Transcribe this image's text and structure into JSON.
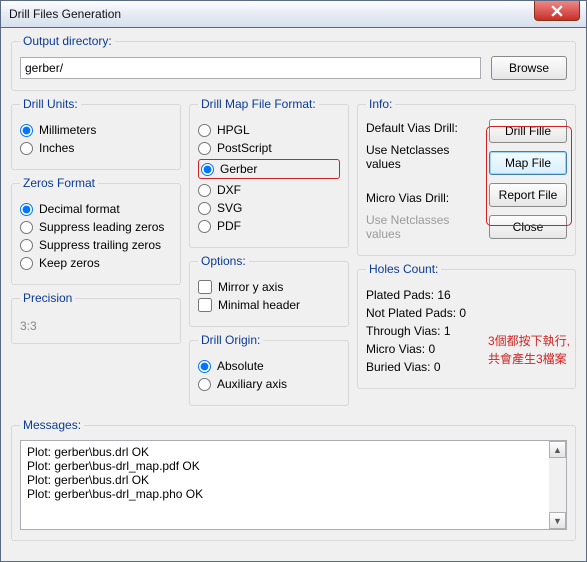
{
  "title": "Drill Files Generation",
  "output": {
    "legend": "Output directory:",
    "value": "gerber/",
    "browse": "Browse"
  },
  "drillUnits": {
    "legend": "Drill Units:",
    "options": {
      "mm": "Millimeters",
      "in": "Inches"
    },
    "selected": "mm"
  },
  "zeros": {
    "legend": "Zeros Format",
    "options": {
      "dec": "Decimal format",
      "sl": "Suppress leading zeros",
      "st": "Suppress trailing zeros",
      "kz": "Keep zeros"
    },
    "selected": "dec"
  },
  "precision": {
    "legend": "Precision",
    "value": "3:3"
  },
  "mapfmt": {
    "legend": "Drill Map File Format:",
    "options": {
      "hpgl": "HPGL",
      "ps": "PostScript",
      "gerber": "Gerber",
      "dxf": "DXF",
      "svg": "SVG",
      "pdf": "PDF"
    },
    "selected": "gerber"
  },
  "options": {
    "legend": "Options:",
    "mirror": "Mirror y axis",
    "minimal": "Minimal header"
  },
  "origin": {
    "legend": "Drill Origin:",
    "options": {
      "abs": "Absolute",
      "aux": "Auxiliary axis"
    },
    "selected": "abs"
  },
  "info": {
    "legend": "Info:",
    "defVias": "Default Vias Drill:",
    "useNet1": "Use Netclasses values",
    "microVias": "Micro Vias Drill:",
    "useNet2": "Use Netclasses values",
    "buttons": {
      "drill": "Drill Fille",
      "map": "Map File",
      "report": "Report File",
      "close": "Close"
    }
  },
  "holes": {
    "legend": "Holes Count:",
    "plated": "Plated Pads: 16",
    "notPlated": "Not Plated Pads: 0",
    "through": "Through Vias: 1",
    "micro": "Micro Vias: 0",
    "buried": "Buried Vias: 0"
  },
  "annotation": {
    "l1": "3個都按下執行,",
    "l2": "共會產生3檔案"
  },
  "messages": {
    "legend": "Messages:",
    "lines": [
      "Plot: gerber\\bus.drl OK",
      "Plot: gerber\\bus-drl_map.pdf OK",
      "Plot: gerber\\bus.drl OK",
      "Plot: gerber\\bus-drl_map.pho OK"
    ]
  }
}
